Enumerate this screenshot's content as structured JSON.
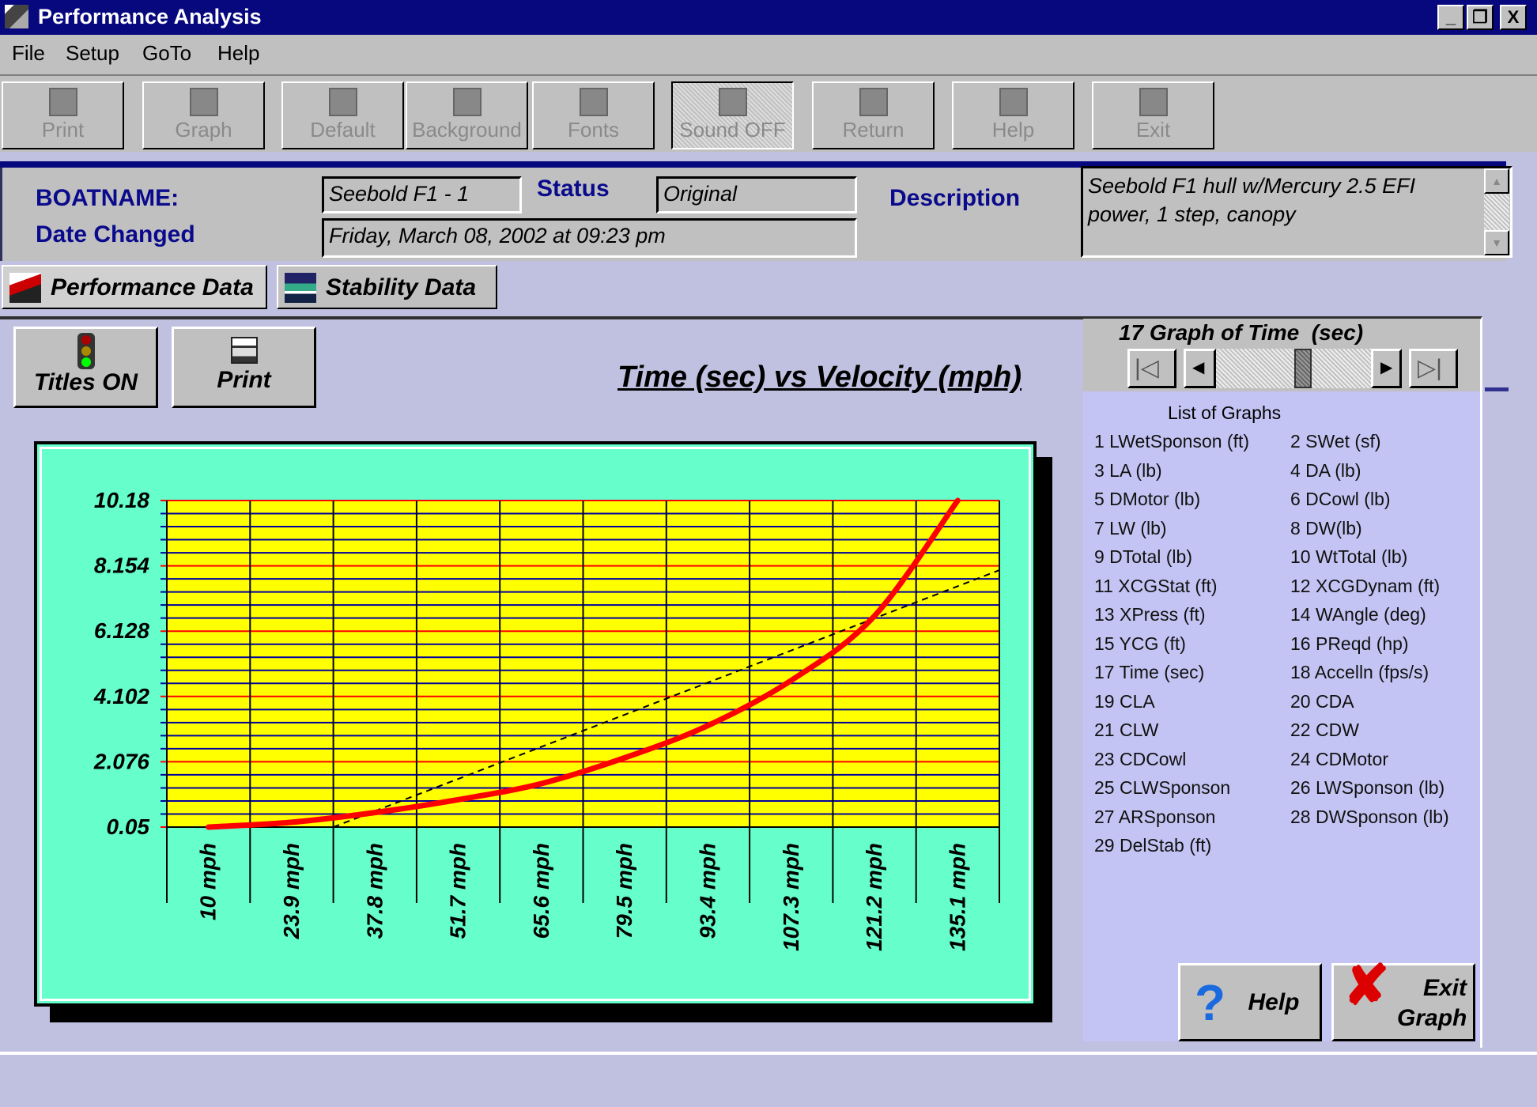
{
  "window": {
    "title": "Performance Analysis",
    "minimize": "_",
    "maximize": "❐",
    "close": "X"
  },
  "menu": [
    {
      "label": "File"
    },
    {
      "label": "Setup"
    },
    {
      "label": "GoTo"
    },
    {
      "label": "Help"
    }
  ],
  "toolbar": [
    {
      "label": "Print",
      "icon": "printer-icon"
    },
    {
      "label": "Graph",
      "icon": "graph-icon"
    },
    {
      "label": "Default",
      "icon": "document-icon"
    },
    {
      "label": "Background",
      "icon": "background-icon"
    },
    {
      "label": "Fonts",
      "icon": "fonts-icon"
    },
    {
      "label": "Sound OFF",
      "icon": "sound-icon",
      "pressed": true
    },
    {
      "label": "Return",
      "icon": "return-icon"
    },
    {
      "label": "Help",
      "icon": "help-icon"
    },
    {
      "label": "Exit",
      "icon": "stop-icon"
    }
  ],
  "info": {
    "boatname_label": "BOATNAME:",
    "boatname": "Seebold F1 - 1",
    "status_label": "Status",
    "status": "Original",
    "date_label": "Date Changed",
    "date": "Friday, March 08, 2002 at 09:23 pm",
    "description_label": "Description",
    "description": "Seebold F1 hull w/Mercury 2.5 EFI power, 1 step, canopy"
  },
  "tabs": [
    {
      "label": "Performance Data",
      "active": true
    },
    {
      "label": "Stability Data"
    }
  ],
  "graph_buttons": {
    "titles": "Titles ON",
    "print": "Print"
  },
  "navigator": {
    "title": "17 Graph of Time  (sec)",
    "position": 17,
    "total": 29
  },
  "list": {
    "title": "List of Graphs",
    "items": [
      "1 LWetSponson (ft)",
      "2 SWet  (sf)",
      "3 LA  (lb)",
      "4 DA  (lb)",
      "5 DMotor  (lb)",
      "6 DCowl  (lb)",
      "7 LW  (lb)",
      "8 DW(lb)",
      "9 DTotal  (lb)",
      "10 WtTotal  (lb)",
      "11 XCGStat  (ft)",
      "12 XCGDynam  (ft)",
      "13 XPress  (ft)",
      "14 WAngle  (deg)",
      "15 YCG  (ft)",
      "16 PReqd  (hp)",
      "17 Time  (sec)",
      "18 Accelln  (fps/s)",
      "19 CLA",
      "20 CDA",
      "21 CLW",
      "22 CDW",
      "23 CDCowl",
      "24 CDMotor",
      "25 CLWSponson",
      "26 LWSponson  (lb)",
      "27 ARSponson",
      "28 DWSponson  (lb)",
      "29 DelStab  (ft)"
    ]
  },
  "bottom_buttons": {
    "help": "Help",
    "exit": "Exit Graph"
  },
  "chart_data": {
    "type": "line",
    "title": "Time  (sec) vs Velocity (mph)",
    "categories": [
      "10 mph",
      "23.9 mph",
      "37.8 mph",
      "51.7 mph",
      "65.6 mph",
      "79.5 mph",
      "93.4 mph",
      "107.3 mph",
      "121.2 mph",
      "135.1 mph"
    ],
    "x": [
      10,
      23.9,
      37.8,
      51.7,
      65.6,
      79.5,
      93.4,
      107.3,
      121.2,
      135.1
    ],
    "series": [
      {
        "values": [
          0.05,
          0.2,
          0.5,
          0.9,
          1.4,
          2.2,
          3.2,
          4.6,
          6.6,
          10.18
        ],
        "color": "#ff0000"
      }
    ],
    "trendline": {
      "points": [
        [
          30.85,
          0.05
        ],
        [
          142.05,
          8.02
        ]
      ],
      "style": "dashed"
    },
    "ytick_labels": [
      "0.05",
      "2.076",
      "4.102",
      "6.128",
      "8.154",
      "10.18"
    ],
    "ylim": [
      0.05,
      10.18
    ],
    "grid": true,
    "colors": {
      "plot_bg": "#ffff00",
      "frame_bg": "#66ffcc",
      "major_grid": "#ff0000",
      "minor_grid": "#0000a0"
    }
  }
}
